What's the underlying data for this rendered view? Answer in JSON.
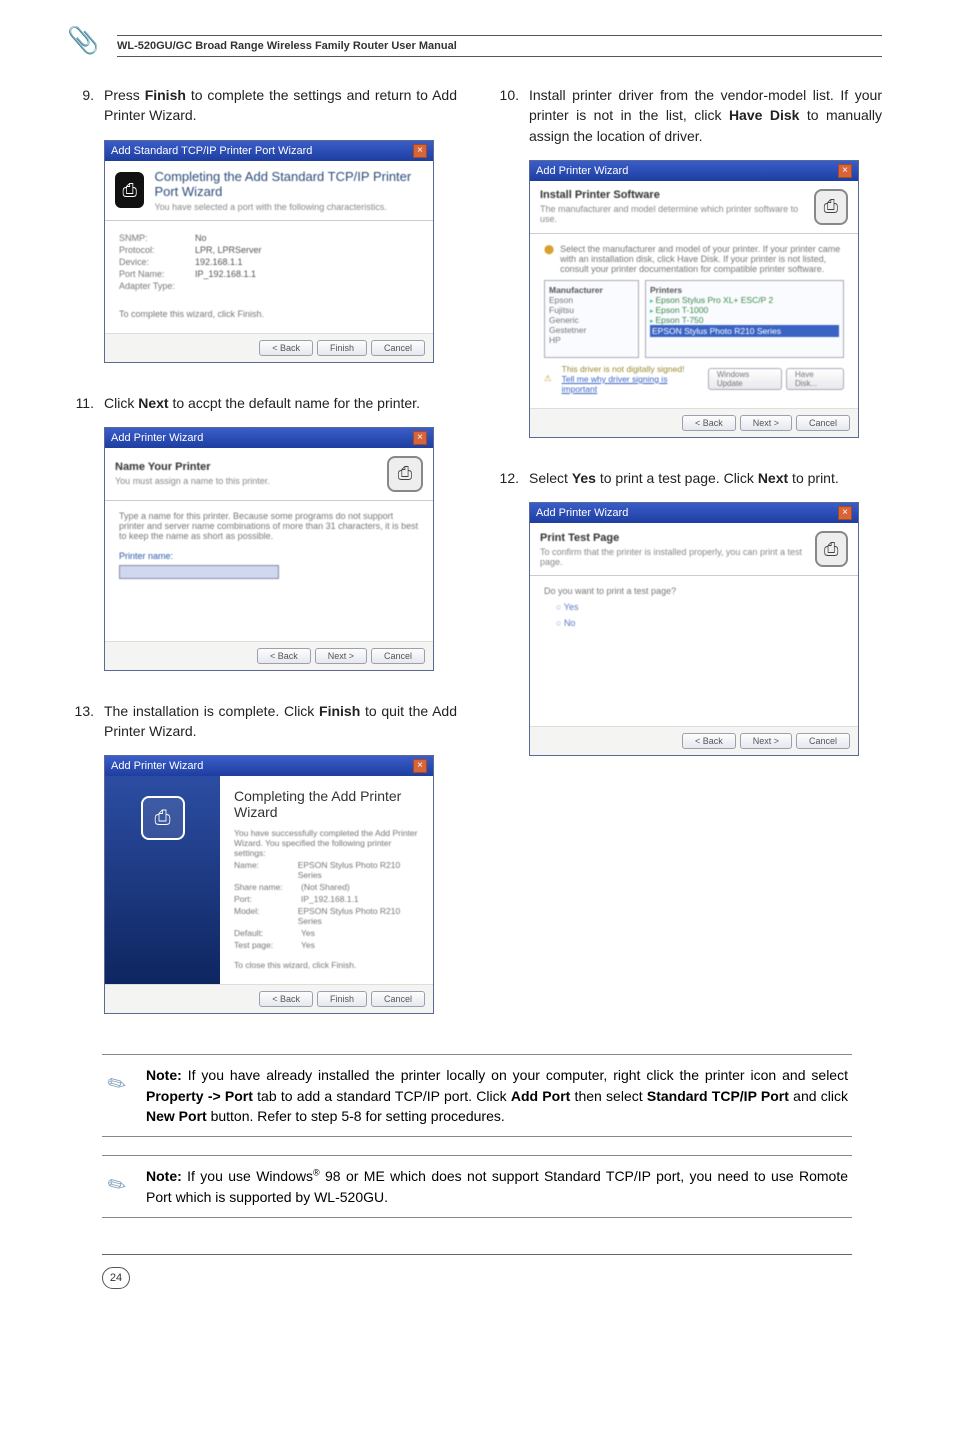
{
  "header": {
    "manual_title": "WL-520GU/GC Broad Range Wireless Family Router User Manual"
  },
  "steps": {
    "s9": {
      "num": "9.",
      "text_a": "Press ",
      "bold_a": "Finish",
      "text_b": " to complete the settings and return to Add Printer Wizard."
    },
    "s10": {
      "num": "10.",
      "text_a": "Install printer driver from the vendor-model list. If your printer is not in the list, click ",
      "bold_a": "Have Disk",
      "text_b": " to manually assign the location of driver."
    },
    "s11": {
      "num": "11.",
      "text_a": "Click ",
      "bold_a": "Next",
      "text_b": " to accpt the default name for the printer."
    },
    "s12": {
      "num": "12.",
      "text_a": "Select ",
      "bold_a": "Yes",
      "text_b": " to print a test page. Click ",
      "bold_b": "Next",
      "text_c": " to print."
    },
    "s13": {
      "num": "13.",
      "text_a": "The installation is complete. Click ",
      "bold_a": "Finish",
      "text_b": " to quit the Add Printer Wizard."
    }
  },
  "dialogs": {
    "d9": {
      "titlebar": "Add Standard TCP/IP Printer Port Wizard",
      "heading": "Completing the Add Standard TCP/IP Printer Port Wizard",
      "sub": "You have selected a port with the following characteristics.",
      "rows": {
        "r1": {
          "k": "SNMP:",
          "v": "No"
        },
        "r2": {
          "k": "Protocol:",
          "v": "LPR, LPRServer"
        },
        "r3": {
          "k": "Device:",
          "v": "192.168.1.1"
        },
        "r4": {
          "k": "Port Name:",
          "v": "IP_192.168.1.1"
        },
        "r5": {
          "k": "Adapter Type:",
          "v": ""
        }
      },
      "foot_hint": "To complete this wizard, click Finish.",
      "btn_back": "< Back",
      "btn_finish": "Finish",
      "btn_cancel": "Cancel"
    },
    "d10": {
      "titlebar": "Add Printer Wizard",
      "heading": "Install Printer Software",
      "sub": "The manufacturer and model determine which printer software to use.",
      "desc": "Select the manufacturer and model of your printer. If your printer came with an installation disk, click Have Disk. If your printer is not listed, consult your printer documentation for compatible printer software.",
      "left_title": "Manufacturer",
      "left_items": {
        "i1": "Epson",
        "i2": "Fujitsu",
        "i3": "Generic",
        "i4": "Gestetner",
        "i5": "HP"
      },
      "right_title": "Printers",
      "right_items": {
        "i1": "Epson Stylus Pro XL+ ESC/P 2",
        "i2": "Epson T-1000",
        "i3": "Epson T-750",
        "i4": "EPSON Stylus Photo R210 Series"
      },
      "signed": "This driver is not digitally signed!",
      "tell": "Tell me why driver signing is important",
      "btn_wu": "Windows Update",
      "btn_hd": "Have Disk...",
      "btn_back": "< Back",
      "btn_next": "Next >",
      "btn_cancel": "Cancel"
    },
    "d11": {
      "titlebar": "Add Printer Wizard",
      "heading": "Name Your Printer",
      "sub": "You must assign a name to this printer.",
      "desc": "Type a name for this printer. Because some programs do not support printer and server name combinations of more than 31 characters, it is best to keep the name as short as possible.",
      "label": "Printer name:",
      "btn_back": "< Back",
      "btn_next": "Next >",
      "btn_cancel": "Cancel"
    },
    "d12": {
      "titlebar": "Add Printer Wizard",
      "heading": "Print Test Page",
      "sub": "To confirm that the printer is installed properly, you can print a test page.",
      "q": "Do you want to print a test page?",
      "opt_yes": "Yes",
      "opt_no": "No",
      "btn_back": "< Back",
      "btn_next": "Next >",
      "btn_cancel": "Cancel"
    },
    "d13": {
      "titlebar": "Add Printer Wizard",
      "heading": "Completing the Add Printer Wizard",
      "sub": "You have successfully completed the Add Printer Wizard. You specified the following printer settings:",
      "rows": {
        "r1": {
          "k": "Name:",
          "v": "EPSON Stylus Photo R210 Series"
        },
        "r2": {
          "k": "Share name:",
          "v": "(Not Shared)"
        },
        "r3": {
          "k": "Port:",
          "v": "IP_192.168.1.1"
        },
        "r4": {
          "k": "Model:",
          "v": "EPSON Stylus Photo R210 Series"
        },
        "r5": {
          "k": "Default:",
          "v": "Yes"
        },
        "r6": {
          "k": "Test page:",
          "v": "Yes"
        }
      },
      "foot_hint": "To close this wizard, click Finish.",
      "btn_back": "< Back",
      "btn_finish": "Finish",
      "btn_cancel": "Cancel"
    }
  },
  "notes": {
    "n1": {
      "label": "Note:",
      "t1": " If you have already installed the printer locally on your computer, right click the printer icon and select ",
      "b1": "Property -> Port",
      "t2": " tab to add a standard TCP/IP port. Click ",
      "b2": "Add Port",
      "t3": " then select ",
      "b3": "Standard TCP/IP Port",
      "t4": " and click ",
      "b4": "New Port",
      "t5": " button. Refer to step 5-8 for setting procedures."
    },
    "n2": {
      "label": "Note:",
      "t1": " If you use Windows",
      "sup": "®",
      "t2": " 98 or ME which does not support Standard TCP/IP port, you need to use Romote Port which is supported by WL-520GU."
    }
  },
  "page_number": "24"
}
